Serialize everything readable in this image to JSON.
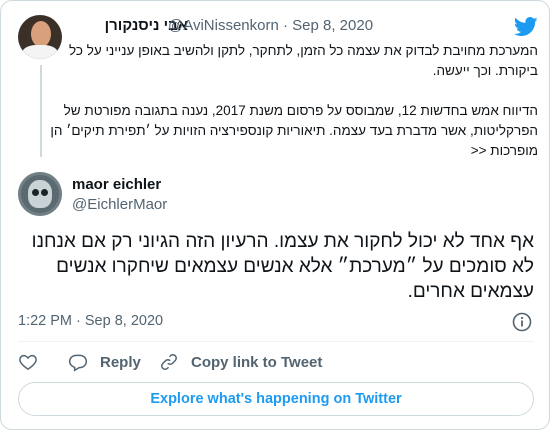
{
  "quoted_tweet": {
    "author_name": "אבי ניסנקורן",
    "handle_and_date": "@AviNissenkorn · Sep 8, 2020",
    "paragraphs": [
      "המערכת מחויבת לבדוק את עצמה כל הזמן, לתחקר, לתקן ולהשיב באופן ענייני על כל ביקורת. וכך ייעשה.",
      "הדיווח אמש בחדשות 12, שמבוסס על פרסום משנת 2017, נענה בתגובה מפורטת של הפרקליטות, אשר מדברת בעד עצמה. תיאוריות קונספירציה הזויות על ׳תפירת תיקים׳ הן מופרכות <<"
    ]
  },
  "main_tweet": {
    "author_name": "maor eichler",
    "handle": "@EichlerMaor",
    "text": "אף אחד לא יכול לחקור את עצמו. הרעיון הזה הגיוני רק אם אנחנו לא סומכים על ״מערכת״ אלא אנשים עצמאים שיחקרו אנשים עצמאים אחרים.",
    "timestamp": "1:22 PM · Sep 8, 2020"
  },
  "actions": {
    "reply_label": "Reply",
    "copy_link_label": "Copy link to Tweet"
  },
  "explore_label": "Explore what's happening on Twitter",
  "icons": {
    "brand": "twitter-bird-icon",
    "like": "heart-icon",
    "reply": "reply-bubble-icon",
    "copy": "link-icon",
    "info": "info-icon"
  },
  "colors": {
    "brand": "#1d9bf0",
    "secondary_text": "#536471",
    "border": "#cfd9de"
  }
}
